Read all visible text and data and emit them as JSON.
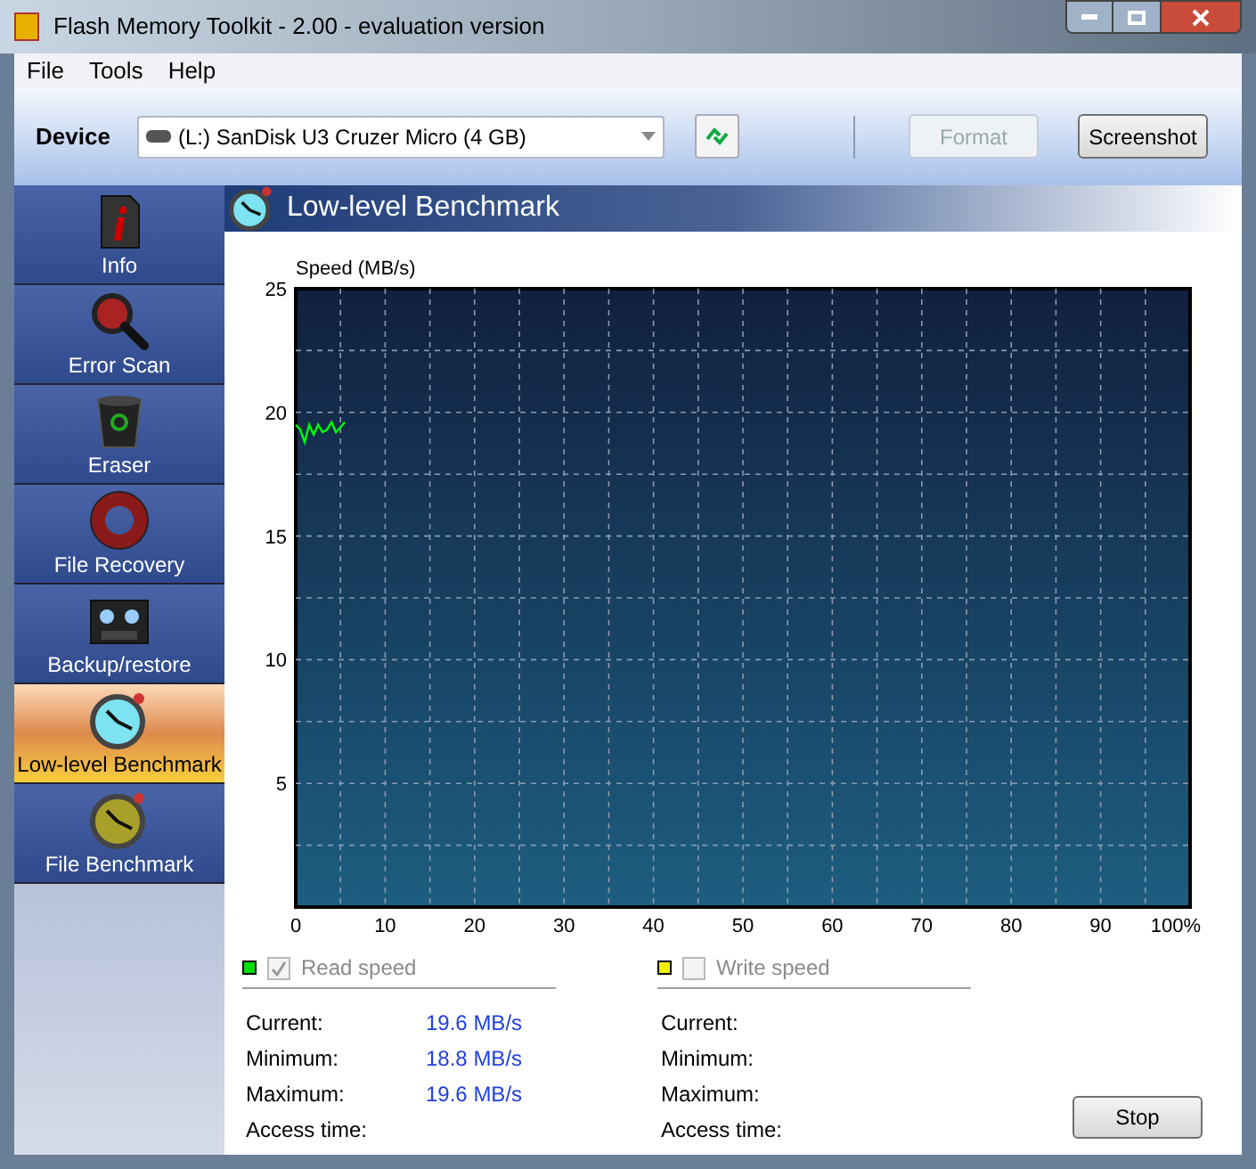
{
  "window": {
    "title": "Flash Memory Toolkit - 2.00 - evaluation version"
  },
  "menu": [
    "File",
    "Tools",
    "Help"
  ],
  "toolbar": {
    "device_label": "Device",
    "device": "(L:) SanDisk U3 Cruzer Micro (4 GB)",
    "buttons": [
      {
        "label": "Format",
        "disabled": true
      },
      {
        "label": "Screenshot",
        "disabled": false
      }
    ]
  },
  "sidebar": {
    "items": [
      {
        "label": "Info",
        "kind": "info",
        "selected": false
      },
      {
        "label": "Error Scan",
        "kind": "magnifier",
        "selected": false
      },
      {
        "label": "Eraser",
        "kind": "bin",
        "selected": false
      },
      {
        "label": "File Recovery",
        "kind": "lifebuoy",
        "selected": false
      },
      {
        "label": "Backup/restore",
        "kind": "tape",
        "selected": false
      },
      {
        "label": "Low-level Benchmark",
        "kind": "stopwatch",
        "selected": true
      },
      {
        "label": "File Benchmark",
        "kind": "stopwatch-gold",
        "selected": false
      }
    ]
  },
  "panel": {
    "title": "Low-level Benchmark",
    "chart_data": {
      "type": "line",
      "grid": true,
      "ylabel": "Speed (MB/s)",
      "xlim": [
        0,
        100
      ],
      "ylim": [
        0,
        25
      ],
      "xticks": [
        0,
        10,
        20,
        30,
        40,
        50,
        60,
        70,
        80,
        90,
        {
          "value": 100,
          "label": "100%"
        }
      ],
      "yticks": [
        5,
        10,
        15,
        20,
        25
      ],
      "series": [
        {
          "name": "Read speed",
          "color": "#00ff00",
          "x": [
            0,
            0.5,
            1,
            1.5,
            2,
            2.5,
            3,
            3.5,
            4,
            4.5,
            5,
            5.5
          ],
          "values": [
            19.5,
            19.3,
            18.8,
            19.5,
            19.1,
            19.5,
            19.2,
            19.3,
            19.6,
            19.2,
            19.4,
            19.6
          ]
        }
      ]
    },
    "legends": [
      {
        "color": "#00e000",
        "checked": true,
        "stats": [
          {
            "label": "Current:",
            "value": "19.6 MB/s"
          },
          {
            "label": "Minimum:",
            "value": "18.8 MB/s"
          },
          {
            "label": "Maximum:",
            "value": "19.6 MB/s"
          },
          {
            "label": "Access time:"
          }
        ]
      },
      {
        "label": "Write speed",
        "color": "#f0f000",
        "checked": false,
        "stats": [
          {
            "label": "Current:"
          },
          {
            "label": "Minimum:"
          },
          {
            "label": "Maximum:"
          },
          {
            "label": "Access time:"
          }
        ]
      }
    ],
    "stop_button": "Stop"
  }
}
